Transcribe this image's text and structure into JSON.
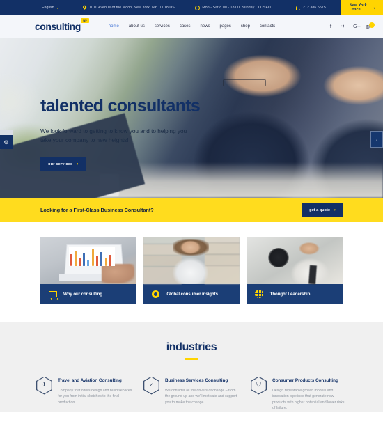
{
  "topbar": {
    "language": "English",
    "address": "1010 Avenue of the Moon, New York, NY 10018 US.",
    "hours": "Mon - Sat 8.00 - 18.00. Sunday CLOSED",
    "phone": "212 386 5575",
    "office": "New York Office",
    "caret": "▾"
  },
  "brand": {
    "name": "consulting",
    "badge": "WP"
  },
  "menu": {
    "items": [
      {
        "label": "home",
        "active": true
      },
      {
        "label": "about us",
        "active": false
      },
      {
        "label": "services",
        "active": false
      },
      {
        "label": "cases",
        "active": false
      },
      {
        "label": "news",
        "active": false
      },
      {
        "label": "pages",
        "active": false
      },
      {
        "label": "shop",
        "active": false
      },
      {
        "label": "contacts",
        "active": false
      }
    ]
  },
  "social": {
    "facebook": "f",
    "twitter": "✈",
    "googleplus": "G+",
    "cart": "⛃"
  },
  "hero": {
    "title": "talented consultants",
    "subtitle": "We look forward to getting to know you and to helping you take your company to new heights!",
    "button": "our services",
    "chevron": "›",
    "next_arrow": "›",
    "gear": "⚙"
  },
  "cta": {
    "text": "Looking for a First-Class Business Consultant?",
    "button": "get a quote",
    "chevron": "›"
  },
  "cards": [
    {
      "label": "Why our consulting",
      "icon": "presentation-board-icon"
    },
    {
      "label": "Global consumer insights",
      "icon": "circle-ring-icon"
    },
    {
      "label": "Thought Leadership",
      "icon": "globe-icon"
    }
  ],
  "industries": {
    "title": "industries",
    "items": [
      {
        "icon": "airplane-icon",
        "glyph": "✈",
        "title": "Travel and Aviation Consulting",
        "text": "Company that offers design and build services for you from initial sketches to the final production."
      },
      {
        "icon": "chart-down-icon",
        "glyph": "↙",
        "title": "Business Services Consulting",
        "text": "We consider all the drivers of change – from the ground up and we'll motivate and support you to make the change."
      },
      {
        "icon": "shopping-cart-icon",
        "glyph": "⛉",
        "title": "Consumer Products Consulting",
        "text": "Design repeatable growth models and innovation pipelines that generate new products with higher potential and lower risks of failure."
      }
    ]
  },
  "colors": {
    "navy": "#123066",
    "yellow": "#ffd400",
    "cta_yellow": "#ffdc1e",
    "card_bar": "#1b3e76",
    "light_grey": "#f0f0f0"
  }
}
